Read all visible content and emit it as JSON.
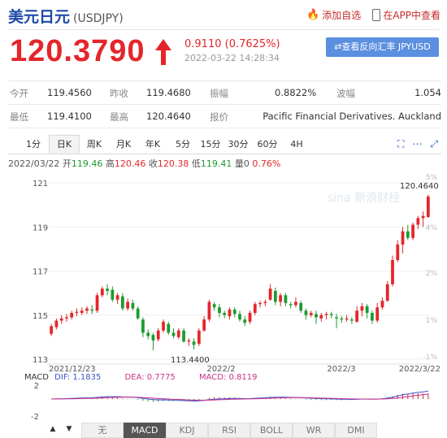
{
  "header": {
    "title": "美元日元",
    "symbol": "(USDJPY)",
    "add_watch": "添加自选",
    "app_view": "在APP中查看"
  },
  "quote": {
    "price": "120.3790",
    "change": "0.9110 (0.7625%)",
    "timestamp": "2022-03-22 14:28:34",
    "reverse_link": "⇄查看反向汇率 JPYUSD"
  },
  "stats": {
    "open_label": "今开",
    "open": "119.4560",
    "prev_label": "昨收",
    "prev": "119.4680",
    "amp_label": "振幅",
    "amp": "0.8822%",
    "wave_label": "波幅",
    "wave": "1.054",
    "low_label": "最低",
    "low": "119.4100",
    "high_label": "最高",
    "high": "120.4640",
    "source_label": "报价",
    "source": "Pacific Financial Derivatives. Auckland"
  },
  "tabs": [
    "1分",
    "日K",
    "周K",
    "月K",
    "年K",
    "5分",
    "15分",
    "30分",
    "60分",
    "4H"
  ],
  "active_tab": "日K",
  "info": {
    "date": "2022/03/22",
    "open_label": "开",
    "open": "119.46",
    "high_label": "高",
    "high": "120.46",
    "close_label": "收",
    "close": "120.38",
    "low_label": "低",
    "low": "119.41",
    "qty_label": "量",
    "qty": "0",
    "pct": "0.76%"
  },
  "chart_data": {
    "type": "candlestick",
    "y_ticks": [
      "121",
      "119",
      "117",
      "115",
      "113"
    ],
    "ylim": [
      113,
      121
    ],
    "pct_ticks": [
      "5%",
      "4%",
      "2%",
      "1%",
      "-1%"
    ],
    "x_labels": [
      "2021/12/23",
      "2022/2",
      "2022/3",
      "2022/3/22"
    ],
    "max_label": "120.4640",
    "min_label": "113.4400",
    "watermark": "sina 新浪财经",
    "up_color": "#e4262b",
    "down_color": "#1a9c2f",
    "candles": [
      [
        114.15,
        114.5,
        114.05,
        114.6
      ],
      [
        114.45,
        114.75,
        114.35,
        114.85
      ],
      [
        114.75,
        114.85,
        114.6,
        115.0
      ],
      [
        114.85,
        114.9,
        114.7,
        115.05
      ],
      [
        114.9,
        115.1,
        114.8,
        115.2
      ],
      [
        115.1,
        115.15,
        114.95,
        115.3
      ],
      [
        115.1,
        115.2,
        115.0,
        115.35
      ],
      [
        115.2,
        115.3,
        115.05,
        115.4
      ],
      [
        115.25,
        115.2,
        115.05,
        115.45
      ],
      [
        115.2,
        115.9,
        115.1,
        116.0
      ],
      [
        115.9,
        116.2,
        115.8,
        116.3
      ],
      [
        116.2,
        116.1,
        115.9,
        116.4
      ],
      [
        116.15,
        115.7,
        115.6,
        116.3
      ],
      [
        115.7,
        115.9,
        115.5,
        116.0
      ],
      [
        115.85,
        115.3,
        115.2,
        116.0
      ],
      [
        115.3,
        115.6,
        115.2,
        115.75
      ],
      [
        115.55,
        115.3,
        115.2,
        115.7
      ],
      [
        115.3,
        114.85,
        114.8,
        115.4
      ],
      [
        114.8,
        114.2,
        114.0,
        114.9
      ],
      [
        114.2,
        114.05,
        113.9,
        114.35
      ],
      [
        114.1,
        113.85,
        113.4,
        114.2
      ],
      [
        113.9,
        114.3,
        113.8,
        114.4
      ],
      [
        114.3,
        114.7,
        114.2,
        114.8
      ],
      [
        114.6,
        114.2,
        114.1,
        114.7
      ],
      [
        114.2,
        114.05,
        113.95,
        114.4
      ],
      [
        114.0,
        114.3,
        113.9,
        114.4
      ],
      [
        114.3,
        113.8,
        113.75,
        114.4
      ],
      [
        113.8,
        113.85,
        113.6,
        113.95
      ],
      [
        113.8,
        113.65,
        113.44,
        113.95
      ],
      [
        113.7,
        114.3,
        113.6,
        114.4
      ],
      [
        114.3,
        114.8,
        114.25,
        114.95
      ],
      [
        114.8,
        115.6,
        114.7,
        115.7
      ],
      [
        115.5,
        115.35,
        115.2,
        115.6
      ],
      [
        115.35,
        115.1,
        114.9,
        115.5
      ],
      [
        115.1,
        115.0,
        114.85,
        115.2
      ],
      [
        114.95,
        115.25,
        114.8,
        115.35
      ],
      [
        115.25,
        115.05,
        114.9,
        115.35
      ],
      [
        115.05,
        114.8,
        114.7,
        115.2
      ],
      [
        114.8,
        114.65,
        114.5,
        114.95
      ],
      [
        114.7,
        115.1,
        114.6,
        115.2
      ],
      [
        115.1,
        115.5,
        115.0,
        115.6
      ],
      [
        115.5,
        115.55,
        115.35,
        115.65
      ],
      [
        115.55,
        115.6,
        115.4,
        115.7
      ],
      [
        115.7,
        116.2,
        115.65,
        116.4
      ],
      [
        116.1,
        115.6,
        115.45,
        116.25
      ],
      [
        115.6,
        115.9,
        115.4,
        116.0
      ],
      [
        115.9,
        115.55,
        115.4,
        116.0
      ],
      [
        115.5,
        115.45,
        115.3,
        115.6
      ],
      [
        115.45,
        115.6,
        115.35,
        115.8
      ],
      [
        115.55,
        115.2,
        115.1,
        115.65
      ],
      [
        115.2,
        115.0,
        114.8,
        115.3
      ],
      [
        115.0,
        115.1,
        114.9,
        115.2
      ],
      [
        115.05,
        114.9,
        114.6,
        115.2
      ],
      [
        114.85,
        115.0,
        114.7,
        115.1
      ],
      [
        115.0,
        115.05,
        114.8,
        115.15
      ],
      [
        115.05,
        115.0,
        114.85,
        115.15
      ],
      [
        114.9,
        114.85,
        114.4,
        115.05
      ],
      [
        114.85,
        114.8,
        114.65,
        114.95
      ],
      [
        114.8,
        114.85,
        114.7,
        115.0
      ],
      [
        114.8,
        114.75,
        114.6,
        114.9
      ],
      [
        114.7,
        115.2,
        114.65,
        115.4
      ],
      [
        115.2,
        115.4,
        114.95,
        115.55
      ],
      [
        115.4,
        115.1,
        114.85,
        115.5
      ],
      [
        115.1,
        114.75,
        114.6,
        115.2
      ],
      [
        114.75,
        115.35,
        114.65,
        115.55
      ],
      [
        115.35,
        115.65,
        115.25,
        115.8
      ],
      [
        115.65,
        116.4,
        115.6,
        116.55
      ],
      [
        116.4,
        117.5,
        116.3,
        117.7
      ],
      [
        117.5,
        118.2,
        117.4,
        118.4
      ],
      [
        118.2,
        118.8,
        117.8,
        119.0
      ],
      [
        118.8,
        118.5,
        118.4,
        119.1
      ],
      [
        118.5,
        119.1,
        118.4,
        119.2
      ],
      [
        119.1,
        119.4,
        118.9,
        119.5
      ],
      [
        119.4,
        119.5,
        119.0,
        119.7
      ],
      [
        119.45,
        120.38,
        119.41,
        120.46
      ]
    ]
  },
  "macd": {
    "label": "MACD",
    "dif_label": "DIF:",
    "dif": "1.1835",
    "dea_label": "DEA:",
    "dea": "0.7775",
    "macd_label": "MACD:",
    "macd": "0.8119",
    "ticks": [
      "2",
      "-2"
    ]
  },
  "bottom_tabs": [
    "无",
    "MACD",
    "KDJ",
    "RSI",
    "BOLL",
    "WR",
    "DMI"
  ],
  "bottom_active": "MACD",
  "nav": [
    "▲",
    "▼"
  ]
}
